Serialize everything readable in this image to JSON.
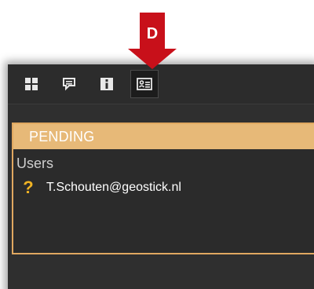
{
  "callout": {
    "label": "D",
    "color": "#c8101a"
  },
  "toolbar": {
    "buttons": [
      {
        "icon": "grid-icon",
        "active": false
      },
      {
        "icon": "comment-icon",
        "active": false
      },
      {
        "icon": "info-icon",
        "active": false
      },
      {
        "icon": "user-card-icon",
        "active": true
      }
    ]
  },
  "pending": {
    "header": "PENDING",
    "users_label": "Users",
    "users": [
      {
        "status_icon": "question-icon",
        "status_glyph": "?",
        "email": "T.Schouten@geostick.nl"
      }
    ]
  },
  "colors": {
    "panel": "#2f2f2f",
    "accent_border": "#e0a860",
    "header_bg": "#e7b978",
    "status_icon": "#f0b324"
  }
}
